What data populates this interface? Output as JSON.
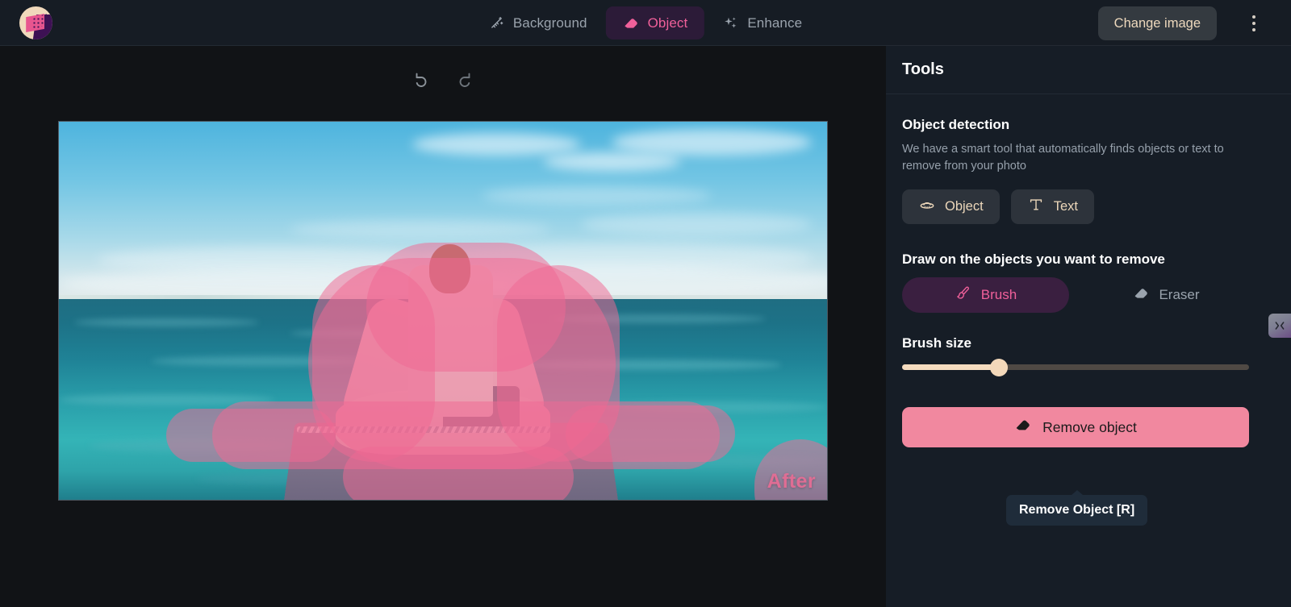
{
  "app": {
    "logo_icon": "app-logo-icon"
  },
  "header": {
    "tabs": [
      {
        "label": "Background",
        "icon": "magic-wand-icon",
        "active": false
      },
      {
        "label": "Object",
        "icon": "eraser-icon",
        "active": true
      },
      {
        "label": "Enhance",
        "icon": "sparkles-icon",
        "active": false
      }
    ],
    "change_image_label": "Change image",
    "more_menu_icon": "kebab-menu-icon"
  },
  "canvas": {
    "undo_icon": "undo-icon",
    "redo_icon": "redo-icon",
    "image_badge": "After"
  },
  "panel": {
    "title": "Tools",
    "object_detection": {
      "title": "Object detection",
      "description": "We have a smart tool that automatically finds objects or text to remove from your photo",
      "buttons": [
        {
          "label": "Object",
          "icon": "ufo-icon"
        },
        {
          "label": "Text",
          "icon": "text-t-icon"
        }
      ]
    },
    "draw": {
      "title": "Draw on the objects you want to remove",
      "modes": [
        {
          "label": "Brush",
          "icon": "brush-icon",
          "active": true
        },
        {
          "label": "Eraser",
          "icon": "eraser-icon",
          "active": false
        }
      ],
      "collapse_icon": "collapse-panel-icon"
    },
    "brush_size": {
      "title": "Brush size",
      "value_percent": 28
    },
    "remove": {
      "label": "Remove object",
      "icon": "eraser-icon",
      "tooltip": "Remove Object [R]"
    }
  },
  "colors": {
    "accent_pink": "#f0609a",
    "button_pink": "#f1889f",
    "cream": "#ecd7ba",
    "panel_bg": "#161d26",
    "canvas_bg": "#111316",
    "topbar_bg": "#161c24",
    "mask_pink": "#ef6a93"
  }
}
